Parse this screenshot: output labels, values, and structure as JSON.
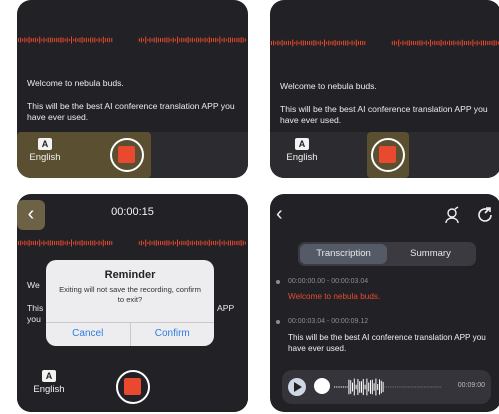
{
  "colors": {
    "panel_bg": "#222226",
    "accent_red": "#e8492f",
    "highlight": "#5a4f31",
    "link_blue": "#2d7de4"
  },
  "screen1": {
    "welcome_text": "Welcome to nebula buds.",
    "body_text": "This will be the best AI conference translation APP you have ever used.",
    "lang_icon_letter": "A",
    "lang_label": "English",
    "lang_icon": "translate-icon",
    "record_icon": "stop-record-icon"
  },
  "screen2": {
    "welcome_text": "Welcome to nebula buds.",
    "body_text": "This will be the best AI conference translation APP you have ever used.",
    "lang_icon_letter": "A",
    "lang_label": "English"
  },
  "screen3": {
    "back_icon": "back-chevron-icon",
    "timer": "00:00:15",
    "hidden_welcome_fragment": "We",
    "hidden_body_fragment": "This",
    "hidden_body_fragment2": "you",
    "hidden_app_fragment": "APP",
    "dialog": {
      "title": "Reminder",
      "message": "Exiting will not save the recording, confirm to exit?",
      "cancel_label": "Cancel",
      "confirm_label": "Confirm"
    },
    "lang_icon_letter": "A",
    "lang_label": "English"
  },
  "screen4": {
    "back_icon": "back-chevron-icon",
    "speaker_icon": "speaker-voice-icon",
    "share_icon": "share-icon",
    "tabs": [
      {
        "label": "Transcription",
        "active": true
      },
      {
        "label": "Summary",
        "active": false
      }
    ],
    "entries": [
      {
        "time": "00:00:00.00 - 00:00:03.04",
        "text": "Welcome to nebula buds.",
        "color": "#e8492f"
      },
      {
        "time": "00:00:03.04 - 00:00:09.12",
        "text": "This will be the best AI conference translation APP you have ever used.",
        "color": "#f0f0f0"
      }
    ],
    "player": {
      "play_icon": "play-icon",
      "duration": "00:09:00",
      "progress": 0.0
    }
  }
}
